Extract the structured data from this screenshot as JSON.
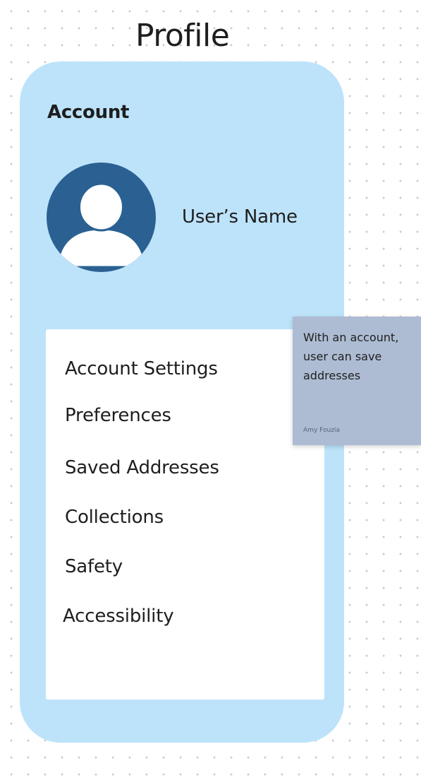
{
  "page": {
    "title": "Profile"
  },
  "account_card": {
    "heading": "Account",
    "avatar_icon": "user-avatar-icon",
    "user_name": "User’s Name",
    "background_color": "#bde3fa"
  },
  "menu": {
    "items": [
      {
        "label": "Account Settings"
      },
      {
        "label": "Preferences"
      },
      {
        "label": "Saved Addresses"
      },
      {
        "label": "Collections"
      },
      {
        "label": "Safety"
      },
      {
        "label": "Accessibility"
      }
    ]
  },
  "sticky_note": {
    "text": "With an account, user can save addresses",
    "author": "Amy Fouzia",
    "color": "#adbcd3"
  },
  "colors": {
    "avatar_fill": "#2a6192",
    "avatar_figure": "#ffffff"
  }
}
